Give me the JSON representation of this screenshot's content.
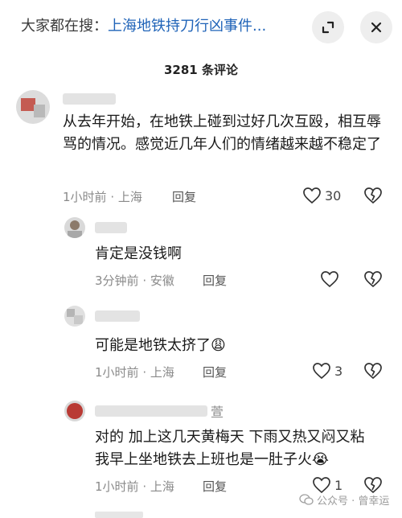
{
  "search_bar": {
    "prefix": "大家都在搜：",
    "query": "上海地铁持刀行凶事件..."
  },
  "comments_header": {
    "count": "3281 条评论"
  },
  "comments": [
    {
      "text": "从去年开始，在地铁上碰到过好几次互殴，相互辱骂的情况。感觉近几年人们的情绪越来越不稳定了",
      "time": "1小时前",
      "location": "上海",
      "reply_label": "回复",
      "likes": "30"
    }
  ],
  "replies": [
    {
      "text": "肯定是没钱啊",
      "time": "3分钟前",
      "location": "安徽",
      "reply_label": "回复",
      "likes": ""
    },
    {
      "text": "可能是地铁太挤了",
      "emoji": "😩",
      "time": "1小时前",
      "location": "上海",
      "reply_label": "回复",
      "likes": "3"
    },
    {
      "name_suffix": "萱",
      "text": "对的 加上这几天黄梅天 下雨又热又闷又粘 我早上坐地铁去上班也是一肚子火",
      "emoji": "😭",
      "time": "1小时前",
      "location": "上海",
      "reply_label": "回复",
      "likes": "1"
    }
  ],
  "separator": "·",
  "watermark": "公众号 · 曾幸运",
  "colors": {
    "link_blue": "#1f63b8",
    "meta_gray": "#8a8a8a"
  },
  "icons": {
    "expand": "expand-icon",
    "close": "close-icon",
    "like": "heart-outline-icon",
    "dislike": "broken-heart-icon",
    "wechat": "wechat-icon"
  }
}
